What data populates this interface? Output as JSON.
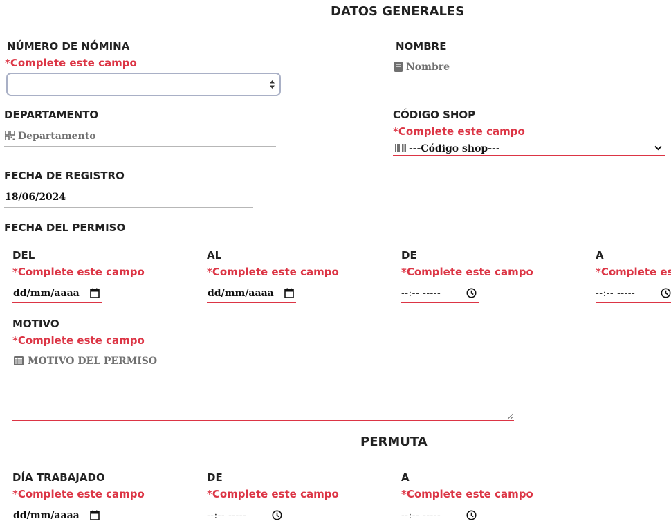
{
  "sections": {
    "general_title": "DATOS GENERALES",
    "permuta_title": "PERMUTA"
  },
  "required_msg": "*Complete este campo",
  "nomina": {
    "label": "NÚMERO DE NÓMINA",
    "value": ""
  },
  "nombre": {
    "label": "NOMBRE",
    "placeholder": "Nombre",
    "icon": "book-icon"
  },
  "departamento": {
    "label": "DEPARTAMENTO",
    "placeholder": "Departamento",
    "icon": "qr-grid-icon"
  },
  "codigo_shop": {
    "label": "CÓDIGO SHOP",
    "selected": "---Código shop---",
    "icon": "barcode-icon"
  },
  "fecha_registro": {
    "label": "FECHA DE REGISTRO",
    "value": "18/06/2024"
  },
  "fecha_permiso": {
    "label": "FECHA DEL PERMISO",
    "del": {
      "label": "DEL",
      "placeholder": "dd/mm/aaaa"
    },
    "al": {
      "label": "AL",
      "placeholder": "dd/mm/aaaa"
    },
    "de": {
      "label": "DE",
      "placeholder": "--:-- -----"
    },
    "a": {
      "label": "A",
      "placeholder": "--:-- -----"
    }
  },
  "motivo": {
    "label": "MOTIVO",
    "placeholder": "MOTIVO DEL PERMISO",
    "icon": "list-icon"
  },
  "permuta": {
    "dia": {
      "label": "DÍA TRABAJADO",
      "placeholder": "dd/mm/aaaa"
    },
    "de": {
      "label": "DE",
      "placeholder": "--:-- -----"
    },
    "a": {
      "label": "A",
      "placeholder": "--:-- -----"
    }
  },
  "colors": {
    "required": "#dc3545",
    "text": "#222222",
    "placeholder": "#707070",
    "underline": "#b7b7b7"
  }
}
